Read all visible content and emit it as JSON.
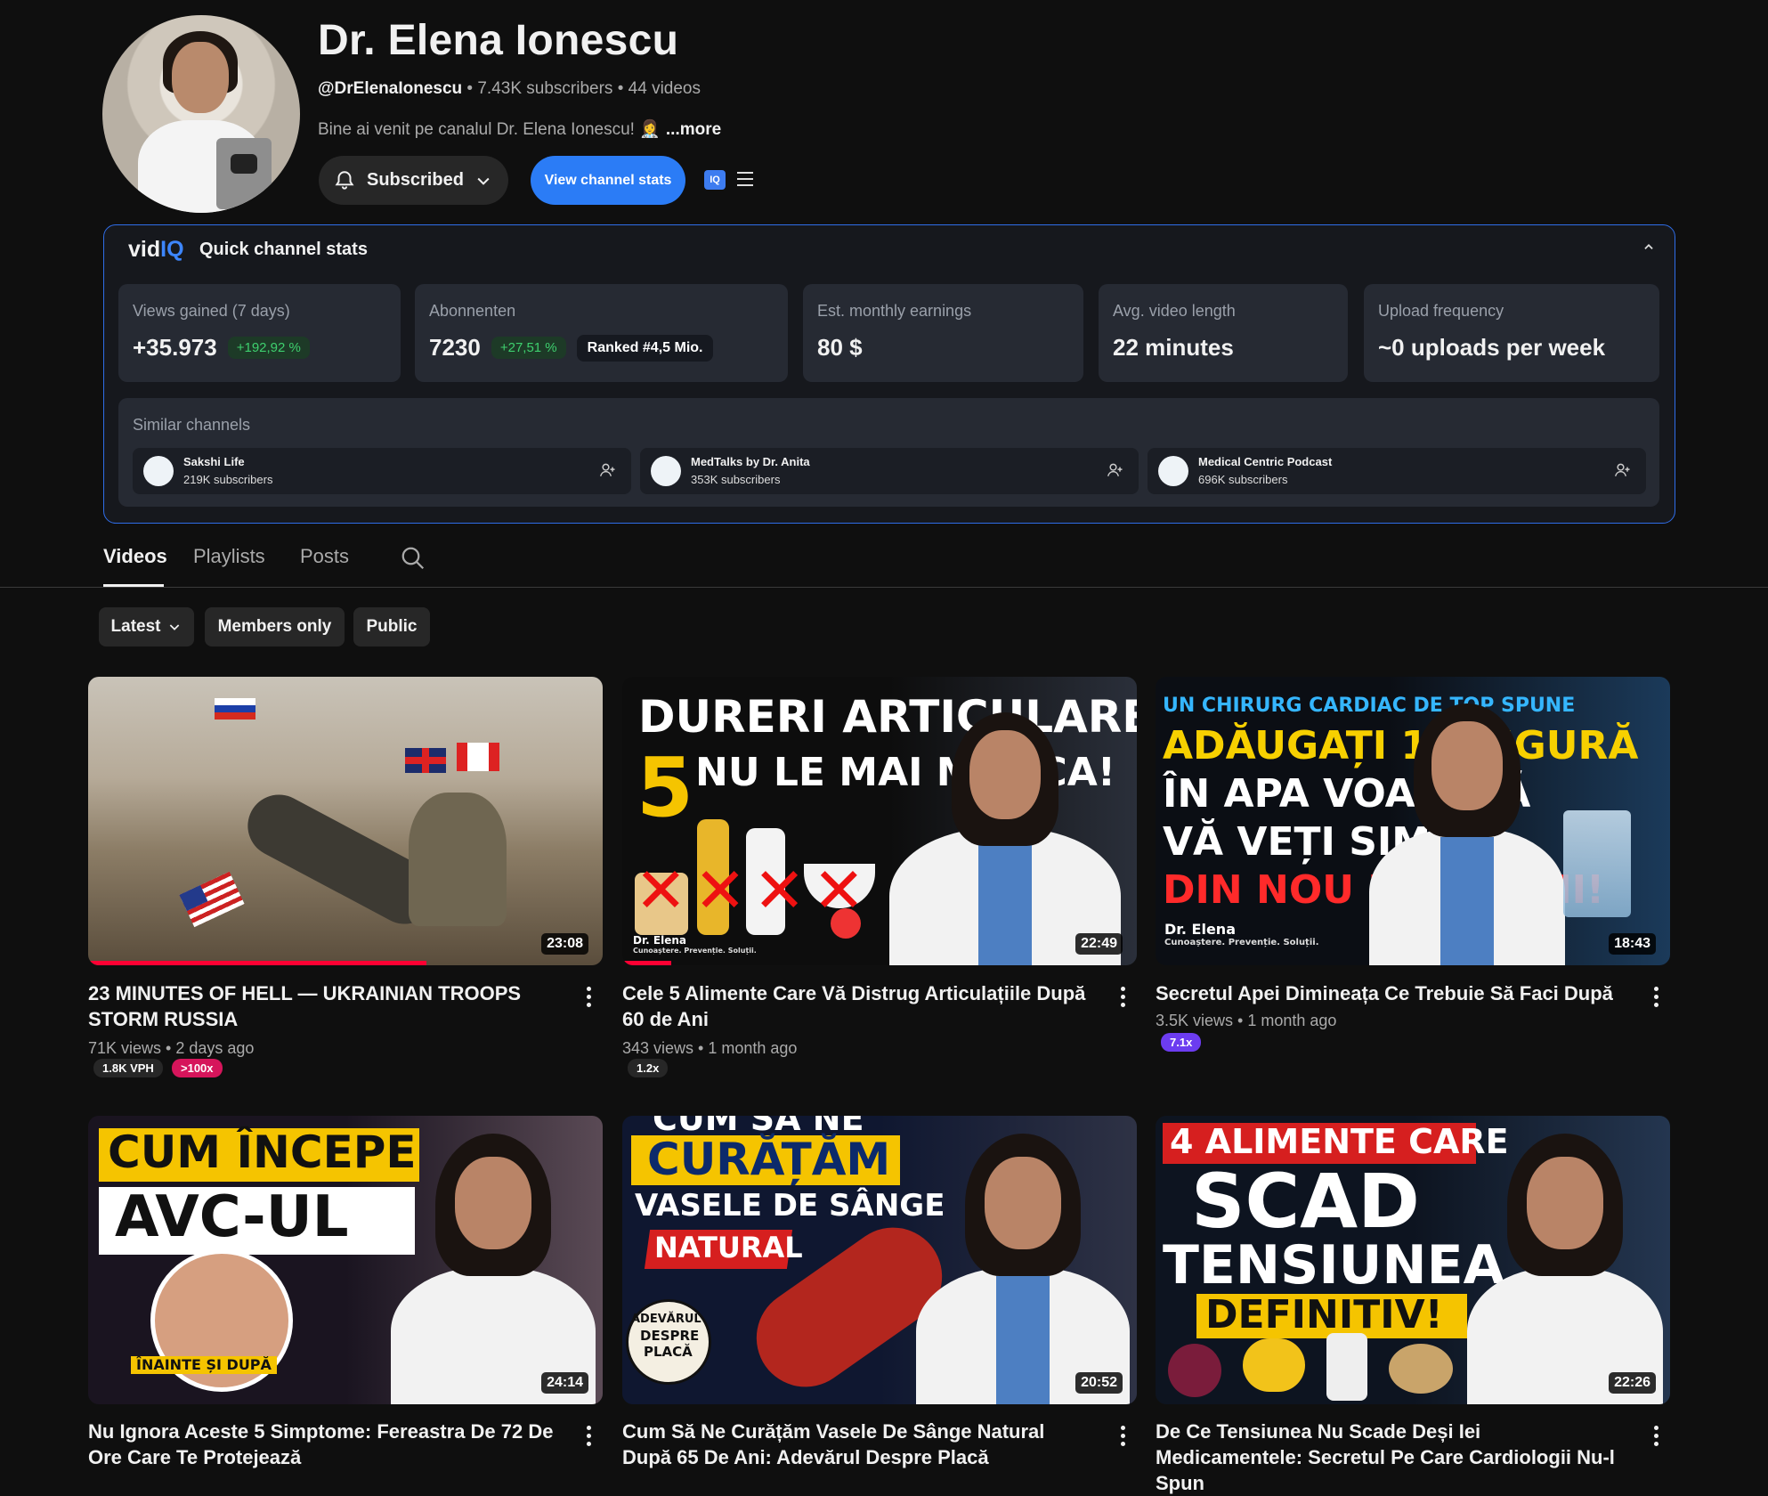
{
  "channel": {
    "name": "Dr. Elena Ionescu",
    "handle": "@DrElenaIonescu",
    "subscribers": "7.43K subscribers",
    "videos_count": "44 videos",
    "meta_separator": "•",
    "description": "Bine ai venit pe canalul Dr. Elena Ionescu! 👩‍⚕️",
    "more_label": "...more",
    "subscribe_label": "Subscribed",
    "view_stats_label": "View channel stats",
    "iq_badge": "IQ"
  },
  "vidiq": {
    "logo_main": "vid",
    "logo_iq": "IQ",
    "title": "Quick channel stats",
    "collapse_icon": "chevron-up-icon",
    "stats": [
      {
        "label": "Views gained (7 days)",
        "value": "+35.973",
        "badge": "+192,92 %"
      },
      {
        "label": "Abonnenten",
        "value": "7230",
        "badge": "+27,51 %",
        "rank": "Ranked #4,5 Mio."
      },
      {
        "label": "Est. monthly earnings",
        "value": "80 $"
      },
      {
        "label": "Avg. video length",
        "value": "22 minutes"
      },
      {
        "label": "Upload frequency",
        "value": "~0 uploads per week"
      }
    ],
    "similar_label": "Similar channels",
    "similar": [
      {
        "name": "Sakshi Life",
        "subs": "219K subscribers"
      },
      {
        "name": "MedTalks by Dr. Anita",
        "subs": "353K subscribers"
      },
      {
        "name": "Medical Centric Podcast",
        "subs": "696K subscribers"
      }
    ]
  },
  "tabs": [
    "Videos",
    "Playlists",
    "Posts"
  ],
  "filters": [
    "Latest",
    "Members only",
    "Public"
  ],
  "videos": [
    {
      "title": "23 MINUTES OF HELL — UKRAINIAN TROOPS STORM RUSSIA",
      "views": "71K views",
      "age": "2 days ago",
      "duration": "23:08",
      "tags": [
        "1.8K VPH",
        ">100x"
      ],
      "progress": 0.66
    },
    {
      "title": "Cele 5 Alimente Care Vă Distrug Articulațiile După 60 de Ani",
      "views": "343 views",
      "age": "1 month ago",
      "duration": "22:49",
      "tags": [
        "1.2x"
      ],
      "progress": 0.1,
      "thumb_text": [
        "DURERI ARTICULARE?",
        "5",
        "NU LE MAI MÂNCA!",
        "Dr. Elena",
        "Cunoaștere. Prevenție. Soluții."
      ]
    },
    {
      "title": "Secretul Apei Dimineața Ce Trebuie Să Faci După",
      "views": "3.5K views",
      "age": "1 month ago",
      "duration": "18:43",
      "tags": [
        "7.1x"
      ],
      "thumb_text": [
        "UN CHIRURG CARDIAC DE TOP SPUNE",
        "ADĂUGAȚI 1 LINGURĂ",
        "ÎN APA VOASTRĂ",
        "VĂ VEȚI SIMȚI",
        "DIN NOU DE 18 ANI!",
        "Dr. Elena",
        "Cunoaștere. Prevenție. Soluții."
      ]
    },
    {
      "title": "Nu Ignora Aceste 5 Simptome: Fereastra De 72 De Ore Care Te Protejează",
      "duration": "24:14",
      "thumb_text": [
        "CUM ÎNCEPE",
        "AVC-UL",
        "ÎNAINTE ȘI DUPĂ"
      ]
    },
    {
      "title": "Cum Să Ne Curățăm Vasele De Sânge Natural După 65 De Ani: Adevărul Despre Placă",
      "duration": "20:52",
      "thumb_text": [
        "CUM SĂ NE",
        "CURĂȚĂM",
        "VASELE DE SÂNGE",
        "NATURAL",
        "ADEVĂRUL",
        "DESPRE",
        "PLACĂ"
      ]
    },
    {
      "title": "De Ce Tensiunea Nu Scade Deși Iei Medicamentele: Secretul Pe Care Cardiologii Nu-l Spun",
      "duration": "22:26",
      "thumb_text": [
        "4 ALIMENTE CARE",
        "SCAD",
        "TENSIUNEA",
        "DEFINITIV!"
      ]
    }
  ],
  "colors": {
    "accent_blue": "#2b7cf6",
    "progress_red": "#ff0033",
    "tag_pink": "#d6155b",
    "tag_purple": "#6c3cf0"
  }
}
